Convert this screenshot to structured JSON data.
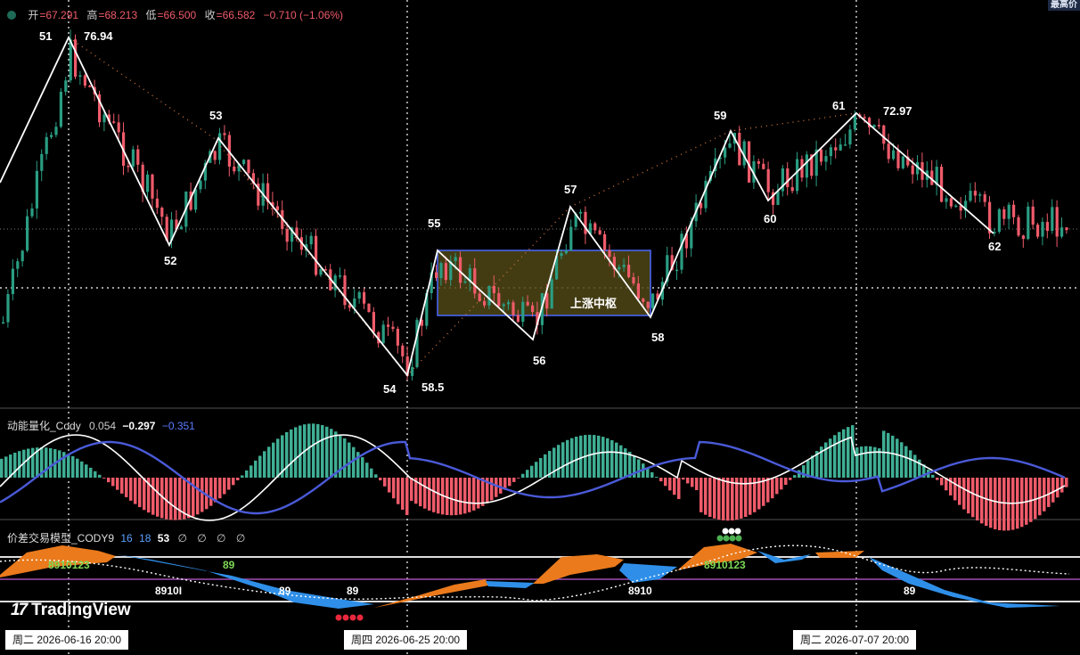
{
  "header": {
    "open_label": "开",
    "open": "=67.291",
    "high_label": "高",
    "high": "=68.213",
    "low_label": "低",
    "low": "=66.500",
    "close_label": "收",
    "close": "=66.582",
    "change": "−0.710 (−1.06%)",
    "corner_label": "最高价"
  },
  "colors": {
    "up": "#2a9d82",
    "down": "#ef5b6a",
    "zone_border": "#4a68ff",
    "zone_fill": "#4f4716",
    "stroke": "#ffffff"
  },
  "chart_data": [
    {
      "type": "candlestick",
      "title": "",
      "pivots": [
        {
          "label": "51",
          "value": 76.94,
          "value_label": "76.94"
        },
        {
          "label": "52"
        },
        {
          "label": "53"
        },
        {
          "label": "54",
          "value": 58.5,
          "value_label": "58.5"
        },
        {
          "label": "55"
        },
        {
          "label": "56"
        },
        {
          "label": "57"
        },
        {
          "label": "58"
        },
        {
          "label": "59"
        },
        {
          "label": "60"
        },
        {
          "label": "61",
          "value": 72.97,
          "value_label": "72.97"
        },
        {
          "label": "62"
        }
      ],
      "zone_label": "上涨中枢",
      "last_ohlc": {
        "open": 67.291,
        "high": 68.213,
        "low": 66.5,
        "close": 66.582
      }
    },
    {
      "type": "histogram+line",
      "name": "动能量化_Cody",
      "values": {
        "a": "0.054",
        "b": "−0.297",
        "c": "−0.351"
      }
    },
    {
      "type": "area",
      "name": "价差交易模型_CODY9",
      "params": [
        "16",
        "18",
        "53"
      ],
      "symbols": "∅ ∅ ∅ ∅",
      "labels": [
        "8910123",
        "89",
        "8910I",
        "89",
        "89",
        "8910",
        "8910123",
        "89"
      ]
    }
  ],
  "date_labels": [
    "周二 2026-06-16   20:00",
    "周四 2026-06-25   20:00",
    "周二 2026-07-07   20:00"
  ],
  "watermark": "TradingView"
}
